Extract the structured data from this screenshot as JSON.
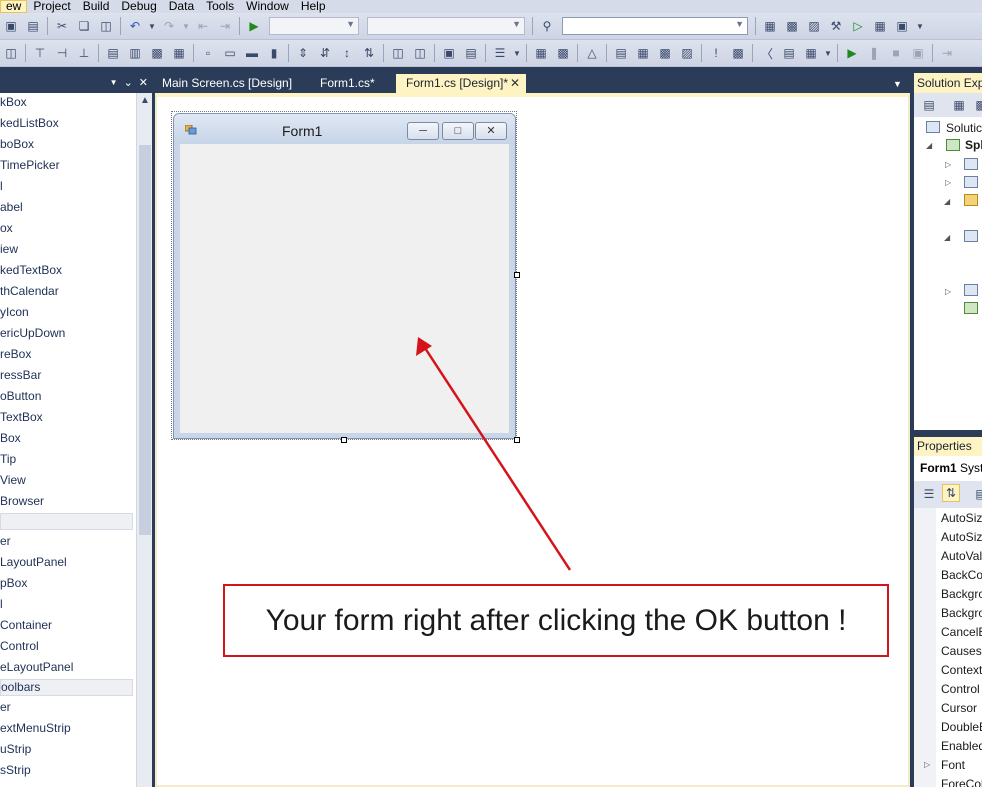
{
  "menubar": {
    "items": [
      "ew",
      "Project",
      "Build",
      "Debug",
      "Data",
      "Tools",
      "Window",
      "Help"
    ],
    "active_index": 0
  },
  "toolbox": {
    "items": [
      "kBox",
      "kedListBox",
      "boBox",
      "TimePicker",
      "l",
      "abel",
      "ox",
      "iew",
      "kedTextBox",
      "thCalendar",
      "yIcon",
      "ericUpDown",
      "reBox",
      "ressBar",
      "oButton",
      "TextBox",
      "Box",
      "Tip",
      "View",
      "Browser"
    ],
    "items2": [
      "er",
      "LayoutPanel",
      "pBox",
      "l",
      "Container",
      "Control",
      "eLayoutPanel"
    ],
    "group_toolbars": "oolbars",
    "items3": [
      "er",
      "extMenuStrip",
      "uStrip",
      "sStrip"
    ]
  },
  "tabs": [
    {
      "label": "Main Screen.cs [Design]",
      "active": false
    },
    {
      "label": "Form1.cs*",
      "active": false
    },
    {
      "label": "Form1.cs [Design]*",
      "active": true
    }
  ],
  "form1": {
    "title": "Form1"
  },
  "annotation": {
    "text": "Your form right after clicking the OK button !",
    "color": "#d4141b"
  },
  "solution_explorer": {
    "title": "Solution Exp",
    "solution_label": "Solutic",
    "project_label": "Spl"
  },
  "properties": {
    "title": "Properties",
    "object_name": "Form1",
    "object_type": "Syst",
    "rows": [
      "AutoSiz",
      "AutoSiz",
      "AutoVal",
      "BackCo",
      "Backgro",
      "Backgro",
      "CancelE",
      "CausesV",
      "Context",
      "Control",
      "Cursor",
      "DoubleE",
      "Enabled",
      "Font",
      "ForeCol"
    ]
  }
}
